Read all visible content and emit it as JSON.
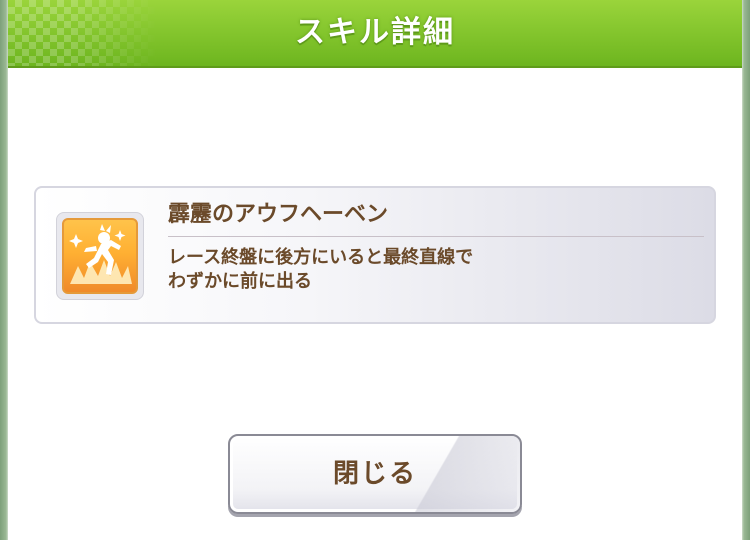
{
  "dialog": {
    "title": "スキル詳細"
  },
  "skill": {
    "name": "霹靂のアウフヘーベン",
    "description_lines": [
      "レース終盤に後方にいると最終直線で",
      "わずかに前に出る"
    ],
    "icon": "running-figure-icon"
  },
  "buttons": {
    "close_label": "閉じる"
  },
  "colors": {
    "header_green": "#7fc22a",
    "text_brown": "#6b4a2a",
    "icon_orange": "#ffb033"
  }
}
